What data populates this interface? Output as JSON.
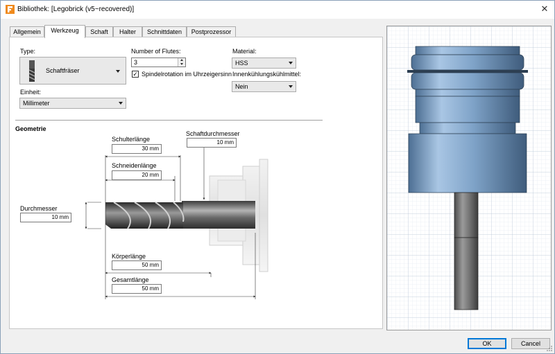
{
  "window": {
    "title": "Bibliothek:  [Legobrick (v5~recovered)]",
    "close_glyph": "✕",
    "app_icon": "fusion-logo-icon"
  },
  "tabs": [
    {
      "label": "Allgemein",
      "active": false
    },
    {
      "label": "Werkzeug",
      "active": true
    },
    {
      "label": "Schaft",
      "active": false
    },
    {
      "label": "Halter",
      "active": false
    },
    {
      "label": "Schnittdaten",
      "active": false
    },
    {
      "label": "Postprozessor",
      "active": false
    }
  ],
  "form": {
    "type_label": "Type:",
    "type_value": "Schaftfräser",
    "einheit_label": "Einheit:",
    "einheit_value": "Millimeter",
    "flutes_label": "Number of Flutes:",
    "flutes_value": "3",
    "spindle_checkbox_label": "Spindelrotation im Uhrzeigersinn",
    "spindle_checked": true,
    "checkmark": "✓",
    "material_label": "Material:",
    "material_value": "HSS",
    "coolant_label": "Innenkühlungskühlmittel:",
    "coolant_value": "Nein"
  },
  "geometry": {
    "heading": "Geometrie",
    "schulterlaenge_label": "Schulterlänge",
    "schulterlaenge_value": "30 mm",
    "schneidenlaenge_label": "Schneidenlänge",
    "schneidenlaenge_value": "20 mm",
    "schaftdurchmesser_label": "Schaftdurchmesser",
    "schaftdurchmesser_value": "10 mm",
    "durchmesser_label": "Durchmesser",
    "durchmesser_value": "10 mm",
    "koerperlaenge_label": "Körperlänge",
    "koerperlaenge_value": "50 mm",
    "gesamtlaenge_label": "Gesamtlänge",
    "gesamtlaenge_value": "50 mm"
  },
  "buttons": {
    "ok": "OK",
    "cancel": "Cancel"
  },
  "colors": {
    "accent": "#0078d7",
    "holder_blue": "#8fb3d6",
    "shaft_gray": "#6e6e6e"
  }
}
